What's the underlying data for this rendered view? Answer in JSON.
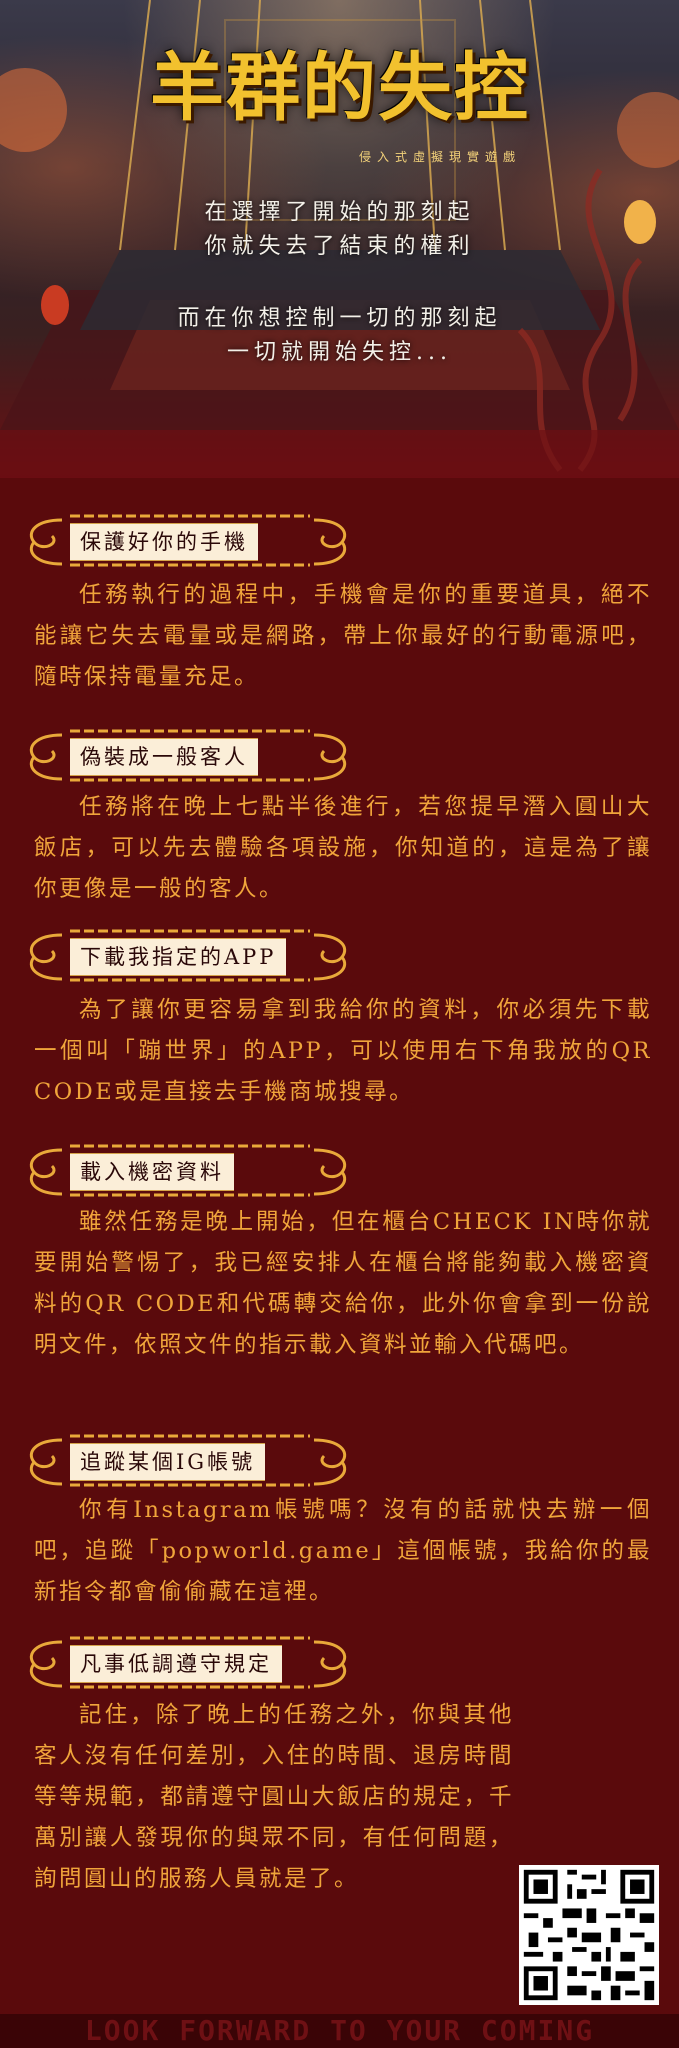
{
  "hero": {
    "title": "羊群的失控",
    "subtitle": "侵入式虛擬現實遊戲",
    "tagline_lines": [
      "在選擇了開始的那刻起",
      "你就失去了結束的權利",
      "而在你想控制一切的那刻起",
      "一切就開始失控..."
    ]
  },
  "sections": [
    {
      "heading": "保護好你的手機",
      "body": "任務執行的過程中，手機會是你的重要道具，絕不能讓它失去電量或是網路，帶上你最好的行動電源吧，隨時保持電量充足。"
    },
    {
      "heading": "偽裝成一般客人",
      "body": "任務將在晚上七點半後進行，若您提早潛入圓山大飯店，可以先去體驗各項設施，你知道的，這是為了讓你更像是一般的客人。"
    },
    {
      "heading": "下載我指定的APP",
      "body": "為了讓你更容易拿到我給你的資料，你必須先下載一個叫「蹦世界」的APP，可以使用右下角我放的QR CODE或是直接去手機商城搜尋。"
    },
    {
      "heading": "載入機密資料",
      "body": "雖然任務是晚上開始，但在櫃台CHECK IN時你就要開始警惕了，我已經安排人在櫃台將能夠載入機密資料的QR CODE和代碼轉交給你，此外你會拿到一份說明文件，依照文件的指示載入資料並輸入代碼吧。"
    },
    {
      "heading": "追蹤某個IG帳號",
      "body": "你有Instagram帳號嗎？沒有的話就快去辦一個吧，追蹤「popworld.game」這個帳號，我給你的最新指令都會偷偷藏在這裡。"
    },
    {
      "heading": "凡事低調遵守規定",
      "body": "記住，除了晚上的任務之外，你與其他客人沒有任何差別，入住的時間、退房時間等等規範，都請遵守圓山大飯店的規定，千萬別讓人發現你的與眾不同，有任何問題，詢問圓山的服務人員就是了。"
    }
  ],
  "footer": "LOOK FORWARD TO YOUR COMING",
  "qr": {
    "label": "qr-code"
  },
  "colors": {
    "background": "#5a0a0c",
    "body_text": "#f0a53b",
    "title": "#f2c12e",
    "heading_bg": "#fbeed8",
    "ornament": "#e9a93a"
  }
}
